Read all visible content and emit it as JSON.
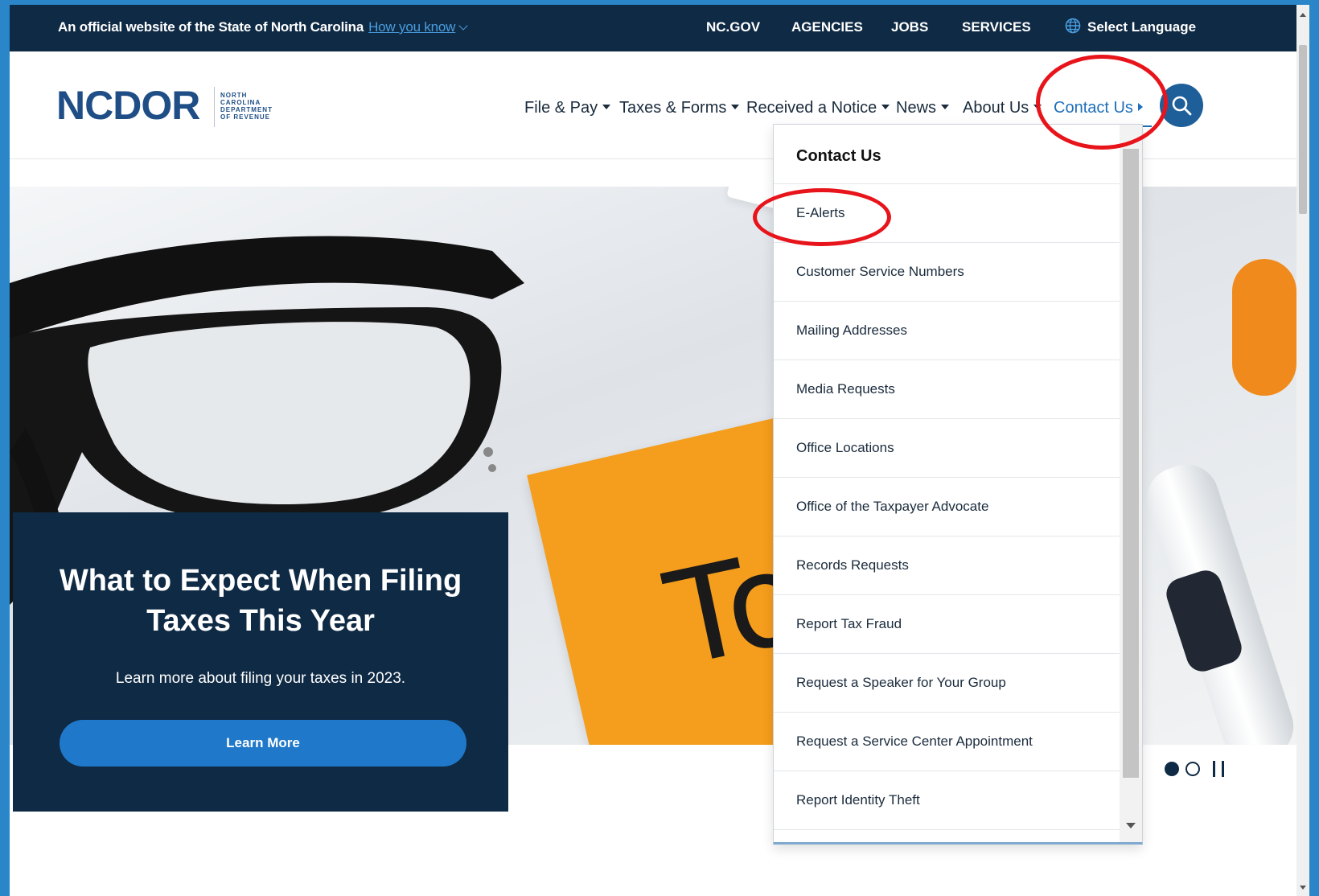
{
  "topbar": {
    "official_text": "An official website of the State of North Carolina",
    "how_you_know": "How you know",
    "links": [
      "NC.GOV",
      "AGENCIES",
      "JOBS",
      "SERVICES"
    ],
    "language": "Select Language"
  },
  "logo": {
    "text": "NCDOR",
    "sub_lines": [
      "NORTH",
      "CAROLINA",
      "DEPARTMENT",
      "OF REVENUE"
    ]
  },
  "nav": {
    "items": [
      "File & Pay",
      "Taxes & Forms",
      "Received a Notice",
      "News",
      "About Us",
      "Contact Us"
    ]
  },
  "dropdown": {
    "heading": "Contact Us",
    "items": [
      "E-Alerts",
      "Customer Service Numbers",
      "Mailing Addresses",
      "Media Requests",
      "Office Locations",
      "Office of the Taxpayer Advocate",
      "Records Requests",
      "Report Tax Fraud",
      "Request a Speaker for Your Group",
      "Request a Service Center Appointment",
      "Report Identity Theft"
    ]
  },
  "hero": {
    "title": "What to Expect When Filing Taxes This Year",
    "subtitle": "Learn more about filing your taxes in 2023.",
    "button": "Learn More",
    "sticky_note_text": "To",
    "slides_total": 2,
    "slide_active": 1
  },
  "colors": {
    "navy": "#0f2a44",
    "brand_blue": "#1f4e86",
    "link_blue": "#1e6fb8",
    "button_blue": "#1f78c9",
    "sticky_orange": "#f59d1c",
    "annotation_red": "#e8141b"
  }
}
